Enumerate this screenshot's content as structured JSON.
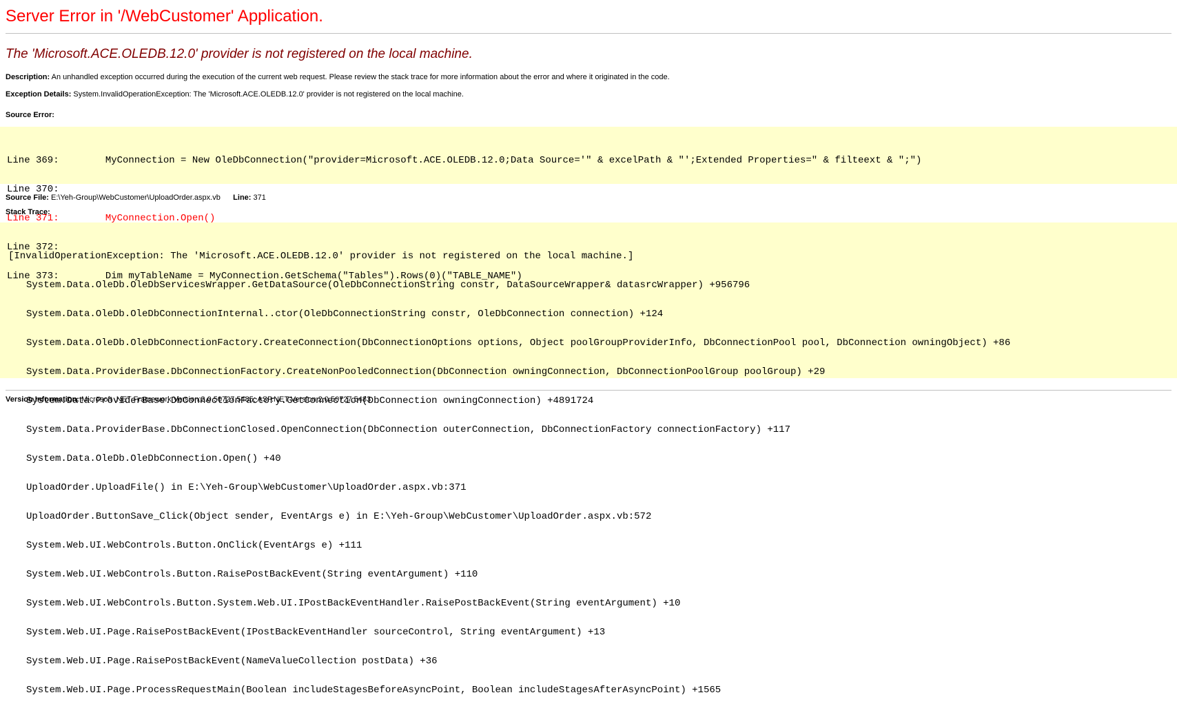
{
  "page_title": "Server Error in '/WebCustomer' Application.",
  "error_message": "The 'Microsoft.ACE.OLEDB.12.0' provider is not registered on the local machine.",
  "description": {
    "label": "Description:",
    "text": " An unhandled exception occurred during the execution of the current web request. Please review the stack trace for more information about the error and where it originated in the code."
  },
  "exception_details": {
    "label": "Exception Details:",
    "text": " System.InvalidOperationException: The 'Microsoft.ACE.OLEDB.12.0' provider is not registered on the local machine."
  },
  "source_error": {
    "label": "Source Error:",
    "lines": [
      "Line 369:        MyConnection = New OleDbConnection(\"provider=Microsoft.ACE.OLEDB.12.0;Data Source='\" & excelPath & \"';Extended Properties=\" & filteext & \";\")",
      "Line 370:",
      "Line 371:        MyConnection.Open()",
      "Line 372:",
      "Line 373:        Dim myTableName = MyConnection.GetSchema(\"Tables\").Rows(0)(\"TABLE_NAME\")"
    ]
  },
  "source_file": {
    "label": "Source File:",
    "value": " E:\\Yeh-Group\\WebCustomer\\UploadOrder.aspx.vb",
    "line_label": "Line:",
    "line_value": " 371"
  },
  "stack_trace": {
    "label": "Stack Trace:",
    "lines": [
      "[InvalidOperationException: The 'Microsoft.ACE.OLEDB.12.0' provider is not registered on the local machine.]",
      "System.Data.OleDb.OleDbServicesWrapper.GetDataSource(OleDbConnectionString constr, DataSourceWrapper& datasrcWrapper) +956796",
      "System.Data.OleDb.OleDbConnectionInternal..ctor(OleDbConnectionString constr, OleDbConnection connection) +124",
      "System.Data.OleDb.OleDbConnectionFactory.CreateConnection(DbConnectionOptions options, Object poolGroupProviderInfo, DbConnectionPool pool, DbConnection owningObject) +86",
      "System.Data.ProviderBase.DbConnectionFactory.CreateNonPooledConnection(DbConnection owningConnection, DbConnectionPoolGroup poolGroup) +29",
      "System.Data.ProviderBase.DbConnectionFactory.GetConnection(DbConnection owningConnection) +4891724",
      "System.Data.ProviderBase.DbConnectionClosed.OpenConnection(DbConnection outerConnection, DbConnectionFactory connectionFactory) +117",
      "System.Data.OleDb.OleDbConnection.Open() +40",
      "UploadOrder.UploadFile() in E:\\Yeh-Group\\WebCustomer\\UploadOrder.aspx.vb:371",
      "UploadOrder.ButtonSave_Click(Object sender, EventArgs e) in E:\\Yeh-Group\\WebCustomer\\UploadOrder.aspx.vb:572",
      "System.Web.UI.WebControls.Button.OnClick(EventArgs e) +111",
      "System.Web.UI.WebControls.Button.RaisePostBackEvent(String eventArgument) +110",
      "System.Web.UI.WebControls.Button.System.Web.UI.IPostBackEventHandler.RaisePostBackEvent(String eventArgument) +10",
      "System.Web.UI.Page.RaisePostBackEvent(IPostBackEventHandler sourceControl, String eventArgument) +13",
      "System.Web.UI.Page.RaisePostBackEvent(NameValueCollection postData) +36",
      "System.Web.UI.Page.ProcessRequestMain(Boolean includeStagesBeforeAsyncPoint, Boolean includeStagesAfterAsyncPoint) +1565"
    ]
  },
  "version_info": {
    "label": "Version Information:",
    "text": " Microsoft .NET Framework Version:2.0.50727.5485; ASP.NET Version:2.0.50727.5483"
  },
  "colors": {
    "title": "#ff0000",
    "error_message": "#800000",
    "code_background": "#ffffcc",
    "highlight_line": "#ff0000"
  }
}
